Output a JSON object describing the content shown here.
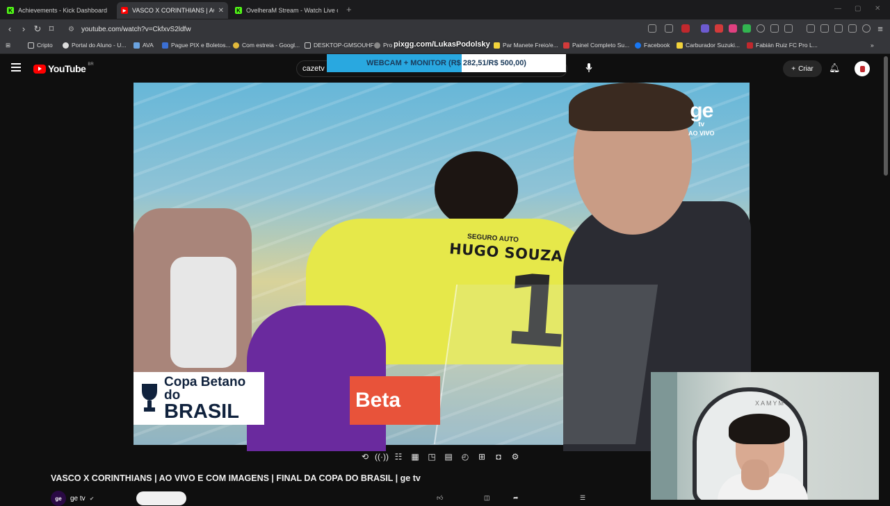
{
  "browser": {
    "tabs": [
      {
        "label": "Achievements - Kick Dashboard",
        "favicon": "kick-icon",
        "active": false
      },
      {
        "label": "VASCO X CORINTHIANS | AO VI",
        "favicon": "youtube-icon",
        "active": true
      },
      {
        "label": "OvelheraM Stream - Watch Live on",
        "favicon": "kick-icon",
        "active": false
      }
    ],
    "url": "youtube.com/watch?v=CkfxvS2ldfw",
    "bookmarks": [
      {
        "label": "Cripto",
        "icon": "folder-icon"
      },
      {
        "label": "Portal do Aluno - U...",
        "icon": "globe-icon"
      },
      {
        "label": "AVA",
        "icon": "ava-icon"
      },
      {
        "label": "Pague PIX e Boletos...",
        "icon": "pix-icon"
      },
      {
        "label": "Com estreia - Googl...",
        "icon": "google-icon"
      },
      {
        "label": "DESKTOP-GMSOUHF",
        "icon": "desktop-icon"
      },
      {
        "label": "Pro",
        "icon": "pro-icon"
      },
      {
        "label": "Par Manete Freio/e...",
        "icon": "ml-icon"
      },
      {
        "label": "Painel Completo Su...",
        "icon": "panel-icon"
      },
      {
        "label": "Facebook",
        "icon": "facebook-icon"
      },
      {
        "label": "Carburador Suzuki...",
        "icon": "ml-icon"
      },
      {
        "label": "Fabián Ruiz FC Pro L...",
        "icon": "futbin-icon"
      }
    ]
  },
  "youtube": {
    "logo_text": "YouTube",
    "region": "BR",
    "search_value": "cazetv",
    "create_label": "Criar",
    "video_title": "VASCO X CORINTHIANS | AO VIVO E COM IMAGENS | FINAL DA COPA DO BRASIL | ge tv",
    "channel_name": "ge tv",
    "channel_avatar_text": "ge"
  },
  "overlay": {
    "pix_text": "pixgg.com/LukasPodolsky",
    "goal_label": "WEBCAM + MONITOR (R$ 282,51/R$ 500,00)",
    "goal_progress": 0.565
  },
  "video": {
    "broadcaster": "ge",
    "broadcaster_sub": "tv",
    "live_label": "AO VIVO",
    "player_name": "HUGO SOUZA",
    "player_number": "1",
    "shirt_sponsor": "SEGURO AUTO",
    "cup_line1": "Copa",
    "cup_brand": "Betano",
    "cup_line2": "do",
    "cup_line3": "BRASIL",
    "board_text": "Beta"
  },
  "webcam": {
    "chair_brand": "XAMYM"
  },
  "colors": {
    "youtube_red": "#ff0000",
    "kick_green": "#53fc18",
    "goal_fill": "#29a8e0",
    "keeper_yellow": "#e6e84a"
  }
}
